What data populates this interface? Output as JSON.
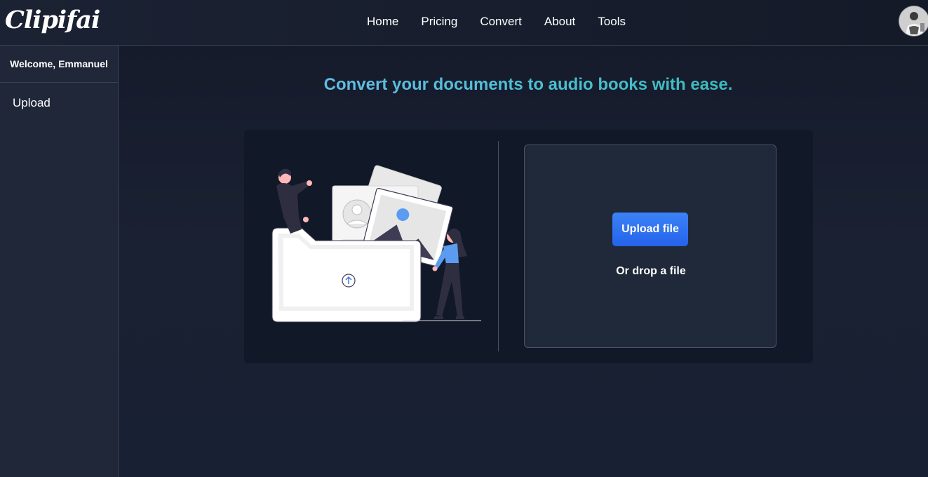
{
  "brand": {
    "logo_text": "Clipifai"
  },
  "nav": {
    "items": [
      {
        "label": "Home"
      },
      {
        "label": "Pricing"
      },
      {
        "label": "Convert"
      },
      {
        "label": "About"
      },
      {
        "label": "Tools"
      }
    ]
  },
  "sidebar": {
    "welcome": "Welcome, Emmanuel",
    "items": [
      {
        "label": "Upload"
      }
    ]
  },
  "main": {
    "headline": "Convert your documents to audio books with ease.",
    "upload_button": "Upload file",
    "drop_text": "Or drop a file"
  },
  "colors": {
    "accent": "#2563eb",
    "background": "#111827",
    "panel": "#1f2939",
    "headline_gradient": [
      "#7ab6f2",
      "#2bb3a3"
    ]
  },
  "icons": {
    "avatar": "user-avatar",
    "illustration": "file-upload-illustration",
    "upload_arrow": "arrow-up-circle-icon"
  }
}
